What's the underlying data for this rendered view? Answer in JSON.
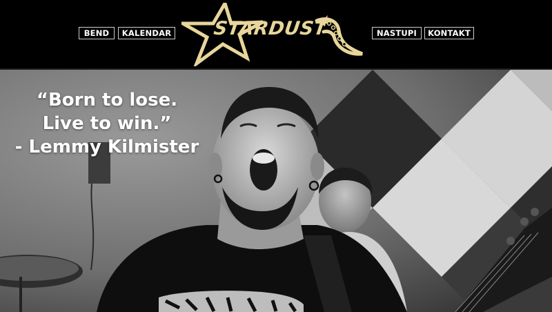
{
  "brand": {
    "logo_text": "STARDUST",
    "accent_color": "#e8d69a"
  },
  "nav": {
    "left": [
      {
        "label": "BEND"
      },
      {
        "label": "KALENDAR"
      }
    ],
    "right": [
      {
        "label": "NASTUPI"
      },
      {
        "label": "KONTAKT"
      }
    ]
  },
  "hero": {
    "quote_lines": [
      "“Born to lose.",
      "Live to win.”",
      "- Lemmy Kilmister"
    ]
  }
}
